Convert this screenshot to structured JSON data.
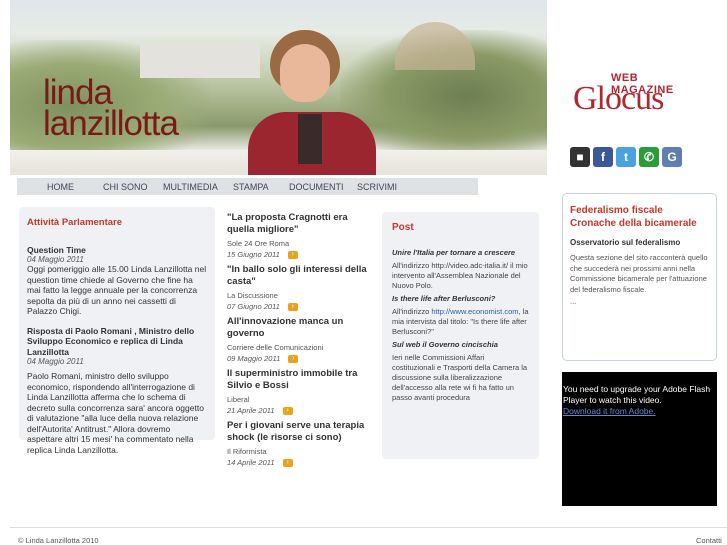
{
  "header": {
    "name_line1": "linda",
    "name_line2": "lanzillotta"
  },
  "logo": {
    "tag": "WEB MAGAZINE",
    "word": "Glocus"
  },
  "social": [
    {
      "icon": "delicious-icon",
      "glyph": "■",
      "color": "#333333"
    },
    {
      "icon": "facebook-icon",
      "glyph": "f",
      "color": "#3b5998"
    },
    {
      "icon": "twitter-icon",
      "glyph": "t",
      "color": "#4aa3df"
    },
    {
      "icon": "chat-icon",
      "glyph": "✆",
      "color": "#2a9d3a"
    },
    {
      "icon": "google-icon",
      "glyph": "G",
      "color": "#5f7fb0"
    }
  ],
  "nav": [
    "HOME",
    "CHI SONO",
    "MULTIMEDIA",
    "STAMPA",
    "DOCUMENTI",
    "SCRIVIMI"
  ],
  "attivita": {
    "title": "Attività Parlamentare",
    "item1_head": "Question Time",
    "item1_date": "04 Maggio 2011",
    "item1_text": "Oggi pomeriggio alle 15.00 Linda Lanzillotta nel question time chiede al Governo  che fine ha mai fatto la legge annuale per la concorrenza sepolta da più di un anno nei cassetti di Palazzo Chigi.",
    "item2_head": "Risposta di Paolo Romani , Ministro dello Sviluppo Economico e replica di Linda Lanzillotta",
    "item2_date": "04 Maggio 2011",
    "item2_text": "Paolo Romani, ministro dello sviluppo economico, rispondendo all'interrogazione di Linda Lanzillotta  afferma che  lo schema di decreto sulla concorrenza sara' ancora oggetto di valutazione \"alla luce della nuova relazione dell'Autorita' Antitrust.\" Allora dovremo aspettare altri 15 mesi' ha commentato nella replica Linda Lanzillotta."
  },
  "news": [
    {
      "title": "\"La proposta Cragnotti era quella migliore\"",
      "source": "Sole 24 Ore Roma",
      "date": "15 Giugno 2011"
    },
    {
      "title": "\"In ballo solo gli interessi della casta\"",
      "source": "La Discussione",
      "date": "07 Giugno 2011"
    },
    {
      "title": "All'innovazione manca un governo",
      "source": "Corriere delle Comunicazioni",
      "date": "09 Maggio 2011"
    },
    {
      "title": "Il superministro immobile tra Silvio e Bossi",
      "source": "Liberal",
      "date": "21 Aprile 2011"
    },
    {
      "title": "Per i giovani serve una terapia shock (le risorse ci sono)",
      "source": "Il Riformista",
      "date": "14 Aprile 2011"
    }
  ],
  "post": {
    "title": "Post",
    "p1_head": "Unire l'Italia per tornare a crescere",
    "p1_text": "All'indirizzo http://video.adc-italia.it/ il mio intervento all'Assemblea Nazionale del Nuovo Polo.",
    "p2_head": "Is there life after Berlusconi?",
    "p2_pre": "All'indirizzo ",
    "p2_link": "http://www.economist.com",
    "p2_post": ", la mia intervista dal titolo: \"Is there life after Berlusconi?\"",
    "p3_head": "Sul web il Governo cincischia",
    "p3_text": "Ieri nelle  Commissioni Affari costituzionali e Trasporti della Camera la discussione sulla liberalizzazione dell'accesso alla rete wi fi ha fatto un passo avanti procedura"
  },
  "federalismo": {
    "title": "Federalismo fiscale Cronache della bicamerale",
    "subtitle": "Osservatorio sul federalismo",
    "text": "Questa sezione del sito racconterà quello che succederà nei prossimi anni nella Commissione bicamerale per l'attuazione del  federalismo fiscale.",
    "more": "..."
  },
  "flash": {
    "message": "You need to upgrade your Adobe Flash Player to watch this video.",
    "link": "Download it from Adobe."
  },
  "footer": {
    "copyright": "© Linda Lanzillotta 2010",
    "contatti": "Contatti"
  }
}
